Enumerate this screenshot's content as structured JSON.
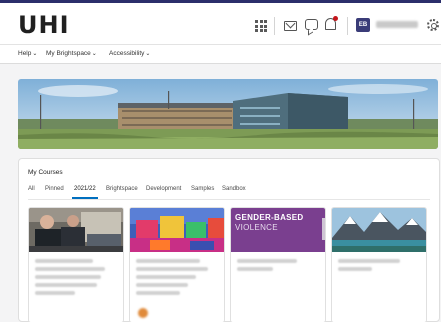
{
  "header": {
    "logo": "UHI",
    "user_initials": "EB"
  },
  "nav": {
    "items": [
      {
        "label": "Help"
      },
      {
        "label": "My Brightspace"
      },
      {
        "label": "Accessibility"
      }
    ]
  },
  "courses": {
    "title": "My Courses",
    "tabs": [
      {
        "label": "All"
      },
      {
        "label": "Pinned"
      },
      {
        "label": "2021/22"
      },
      {
        "label": "Brightspace"
      },
      {
        "label": "Development"
      },
      {
        "label": "Samples"
      },
      {
        "label": "Sandbox"
      }
    ],
    "active_tab": "2021/22",
    "cards": [
      {
        "image": "workshop-photo"
      },
      {
        "image": "bouncy-castle-photo"
      },
      {
        "image": "gbv-graphic",
        "title": "GENDER-BASED",
        "subtitle": "VIOLENCE"
      },
      {
        "image": "mountain-lake-photo"
      }
    ]
  },
  "colors": {
    "brand_navy": "#2b2f6b",
    "accent_blue": "#006fbf",
    "gbv_purple": "#7a3f8f",
    "notification_red": "#c4161c"
  }
}
